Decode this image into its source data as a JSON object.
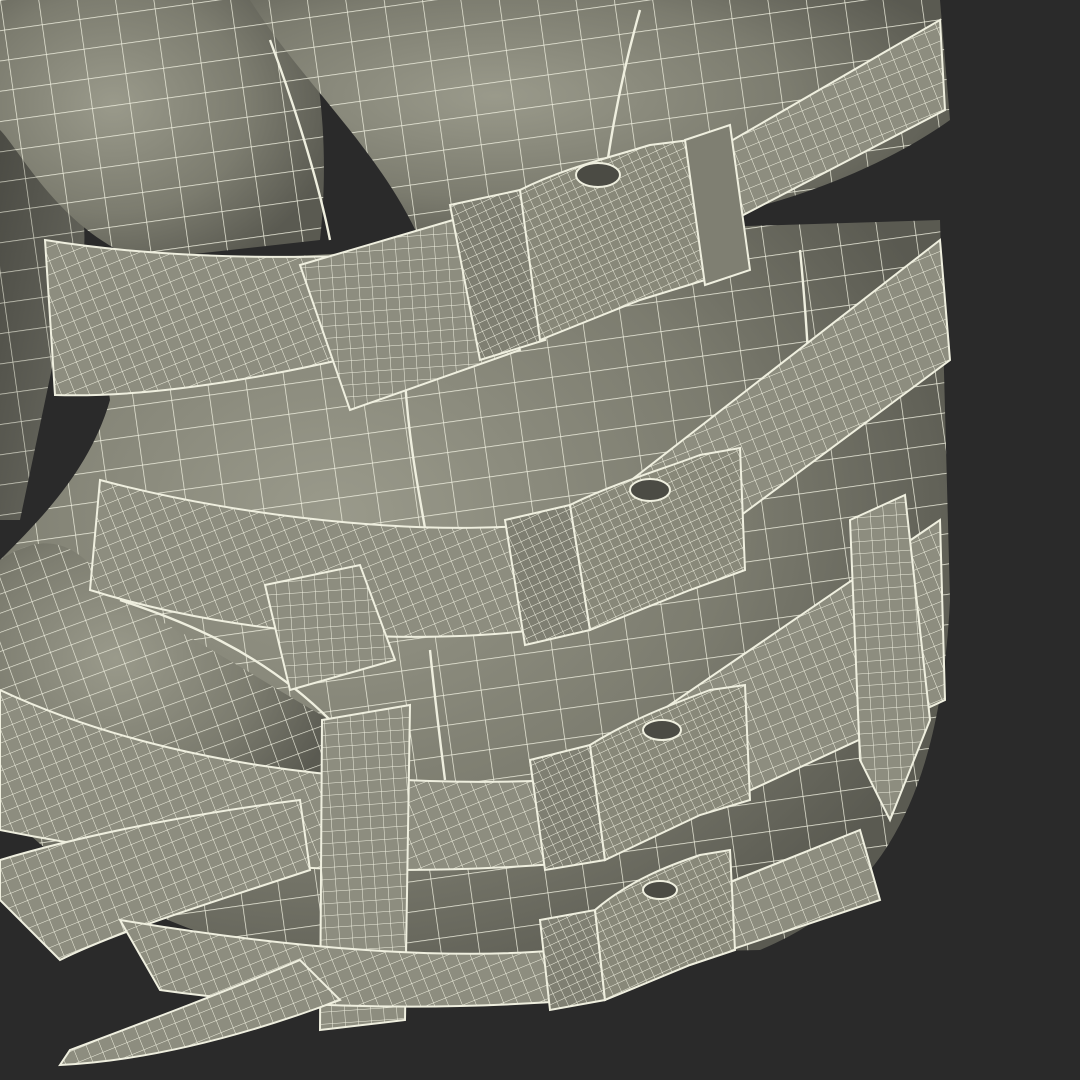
{
  "scene": {
    "subject": "life-vest-wireframe",
    "colors": {
      "background": "#2a2a2a",
      "shell": "#858577",
      "shell_shadow": "#5f5f55",
      "shell_light": "#a2a293",
      "strap": "#8d8d7f",
      "wire": "#eeeede"
    },
    "buckles": 4,
    "straps": 5
  }
}
